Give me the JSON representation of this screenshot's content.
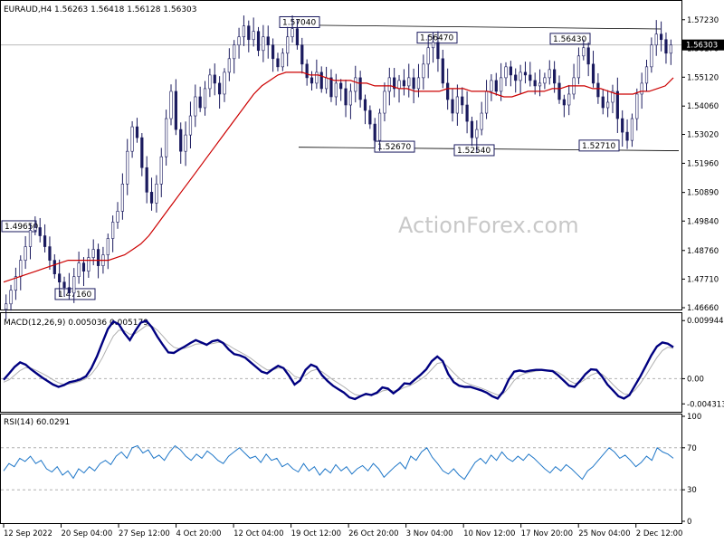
{
  "price_panel": {
    "header": "EURAUD,H4  1.56263 1.56418 1.56128 1.56303",
    "current_price_label": "1.56303",
    "watermark": "ActionForex.com",
    "y_ticks": [
      "1.57230",
      "1.56170",
      "1.55120",
      "1.54060",
      "1.53020",
      "1.51960",
      "1.50890",
      "1.49840",
      "1.48760",
      "1.47710",
      "1.46660"
    ]
  },
  "macd_panel": {
    "header": "MACD(12,26,9) 0.005036 0.005179",
    "y_ticks": [
      "0.009944",
      "0.00",
      "-0.004313"
    ]
  },
  "rsi_panel": {
    "header": "RSI(14) 60.0291",
    "y_ticks": [
      "100",
      "70",
      "30",
      "0"
    ]
  },
  "x_ticks": [
    "12 Sep 2022",
    "20 Sep 04:00",
    "27 Sep 12:00",
    "4 Oct 20:00",
    "12 Oct 04:00",
    "19 Oct 12:00",
    "26 Oct 20:00",
    "3 Nov 04:00",
    "10 Nov 12:00",
    "17 Nov 20:00",
    "25 Nov 04:00",
    "2 Dec 12:00"
  ],
  "colors": {
    "candles": "#1a1a5e",
    "sma": "#cc0000",
    "macd_line": "#000080",
    "signal_line": "#b0b0b0",
    "rsi": "#1f77c8",
    "grid": "#b0b0b0"
  },
  "chart_data": [
    {
      "type": "candlestick",
      "title": "EURAUD,H4",
      "ohlc_last": {
        "open": 1.56263,
        "high": 1.56418,
        "low": 1.56128,
        "close": 1.56303
      },
      "ylim": [
        1.4666,
        1.5782
      ],
      "x": [
        "12 Sep 2022",
        "20 Sep 04:00",
        "27 Sep 12:00",
        "4 Oct 20:00",
        "12 Oct 04:00",
        "19 Oct 12:00",
        "26 Oct 20:00",
        "3 Nov 04:00",
        "10 Nov 12:00",
        "17 Nov 20:00",
        "25 Nov 04:00",
        "2 Dec 12:00"
      ],
      "close_path": [
        1.468,
        1.473,
        1.478,
        1.484,
        1.489,
        1.495,
        1.496,
        1.493,
        1.489,
        1.484,
        1.479,
        1.476,
        1.474,
        1.472,
        1.478,
        1.483,
        1.48,
        1.485,
        1.488,
        1.482,
        1.486,
        1.492,
        1.498,
        1.502,
        1.512,
        1.524,
        1.533,
        1.529,
        1.518,
        1.509,
        1.505,
        1.512,
        1.522,
        1.536,
        1.546,
        1.532,
        1.524,
        1.53,
        1.537,
        1.544,
        1.54,
        1.547,
        1.552,
        1.549,
        1.545,
        1.553,
        1.558,
        1.563,
        1.566,
        1.57,
        1.565,
        1.568,
        1.561,
        1.566,
        1.563,
        1.558,
        1.555,
        1.56,
        1.566,
        1.569,
        1.563,
        1.556,
        1.551,
        1.549,
        1.553,
        1.547,
        1.551,
        1.544,
        1.549,
        1.547,
        1.541,
        1.546,
        1.551,
        1.543,
        1.539,
        1.534,
        1.528,
        1.538,
        1.546,
        1.551,
        1.547,
        1.55,
        1.548,
        1.551,
        1.547,
        1.551,
        1.556,
        1.562,
        1.564,
        1.558,
        1.549,
        1.543,
        1.538,
        1.544,
        1.541,
        1.535,
        1.529,
        1.532,
        1.538,
        1.546,
        1.55,
        1.546,
        1.551,
        1.555,
        1.552,
        1.55,
        1.553,
        1.552,
        1.55,
        1.548,
        1.549,
        1.551,
        1.554,
        1.549,
        1.543,
        1.541,
        1.545,
        1.551,
        1.559,
        1.562,
        1.556,
        1.549,
        1.544,
        1.54,
        1.542,
        1.546,
        1.536,
        1.531,
        1.528,
        1.536,
        1.545,
        1.549,
        1.555,
        1.563,
        1.567,
        1.565,
        1.56,
        1.563
      ],
      "sma_path": [
        1.476,
        1.477,
        1.478,
        1.479,
        1.48,
        1.481,
        1.482,
        1.483,
        1.484,
        1.484,
        1.484,
        1.484,
        1.484,
        1.484,
        1.485,
        1.486,
        1.488,
        1.49,
        1.493,
        1.497,
        1.501,
        1.505,
        1.509,
        1.513,
        1.517,
        1.521,
        1.525,
        1.529,
        1.533,
        1.537,
        1.541,
        1.545,
        1.548,
        1.55,
        1.552,
        1.553,
        1.553,
        1.553,
        1.552,
        1.552,
        1.551,
        1.55,
        1.55,
        1.55,
        1.549,
        1.549,
        1.548,
        1.548,
        1.548,
        1.547,
        1.547,
        1.546,
        1.546,
        1.546,
        1.546,
        1.547,
        1.547,
        1.547,
        1.546,
        1.546,
        1.546,
        1.545,
        1.544,
        1.544,
        1.545,
        1.546,
        1.546,
        1.546,
        1.547,
        1.547,
        1.548,
        1.548,
        1.548,
        1.547,
        1.547,
        1.546,
        1.545,
        1.545,
        1.545,
        1.546,
        1.546,
        1.547,
        1.548,
        1.551
      ],
      "levels": [
        {
          "label": "1.49650",
          "value": 1.4965
        },
        {
          "label": "1.47160",
          "value": 1.4716
        },
        {
          "label": "1.57040",
          "value": 1.5704
        },
        {
          "label": "1.56470",
          "value": 1.5647
        },
        {
          "label": "1.52670",
          "value": 1.5267
        },
        {
          "label": "1.52540",
          "value": 1.5254
        },
        {
          "label": "1.56430",
          "value": 1.5643
        },
        {
          "label": "1.52710",
          "value": 1.5271
        }
      ],
      "current_price": 1.56303
    },
    {
      "type": "line",
      "title": "MACD(12,26,9)",
      "values_last": {
        "macd": 0.005036,
        "signal": 0.005179
      },
      "ylim": [
        -0.0052,
        0.0106
      ],
      "series": [
        {
          "name": "MACD",
          "values": [
            -0.0002,
            0.0009,
            0.002,
            0.0028,
            0.0024,
            0.0016,
            0.0009,
            0.0002,
            -0.0004,
            -0.001,
            -0.0014,
            -0.0011,
            -0.0006,
            -0.0004,
            -0.0001,
            0.0004,
            0.0018,
            0.0038,
            0.0062,
            0.0085,
            0.0098,
            0.0093,
            0.0078,
            0.0066,
            0.0082,
            0.0096,
            0.0099,
            0.0088,
            0.0072,
            0.0058,
            0.0045,
            0.0044,
            0.005,
            0.0055,
            0.0061,
            0.0066,
            0.0062,
            0.0058,
            0.0064,
            0.0066,
            0.0061,
            0.005,
            0.0042,
            0.004,
            0.0036,
            0.0028,
            0.002,
            0.0012,
            0.0009,
            0.0016,
            0.0022,
            0.0018,
            0.0005,
            -0.001,
            -0.0003,
            0.0015,
            0.0024,
            0.002,
            0.0006,
            -0.0004,
            -0.0012,
            -0.0018,
            -0.0024,
            -0.0032,
            -0.0035,
            -0.003,
            -0.0026,
            -0.0028,
            -0.0024,
            -0.0015,
            -0.0017,
            -0.0025,
            -0.0018,
            -0.0008,
            -0.0009,
            -0.0001,
            0.0007,
            0.0016,
            0.003,
            0.0038,
            0.003,
            0.0008,
            -0.0006,
            -0.0012,
            -0.0014,
            -0.0014,
            -0.0017,
            -0.002,
            -0.0024,
            -0.003,
            -0.0034,
            -0.0022,
            -0.0002,
            0.0012,
            0.0014,
            0.0012,
            0.0014,
            0.0015,
            0.0015,
            0.0014,
            0.0013,
            0.0006,
            -0.0003,
            -0.0012,
            -0.0014,
            -0.0004,
            0.0008,
            0.0016,
            0.0015,
            0.0004,
            -0.001,
            -0.002,
            -0.003,
            -0.0034,
            -0.0028,
            -0.0012,
            0.0004,
            0.0022,
            0.004,
            0.0055,
            0.0062,
            0.006,
            0.0054
          ]
        },
        {
          "name": "Signal",
          "values": [
            -0.0006,
            -0.0002,
            0.0006,
            0.0014,
            0.0019,
            0.0018,
            0.0014,
            0.0009,
            0.0004,
            -0.0002,
            -0.0007,
            -0.001,
            -0.0009,
            -0.0007,
            -0.0004,
            0.0,
            0.0008,
            0.002,
            0.0036,
            0.0055,
            0.0073,
            0.0083,
            0.0082,
            0.0076,
            0.0077,
            0.0084,
            0.0091,
            0.009,
            0.0083,
            0.0073,
            0.0062,
            0.0054,
            0.0051,
            0.0052,
            0.0055,
            0.0059,
            0.006,
            0.0059,
            0.006,
            0.0062,
            0.0062,
            0.0057,
            0.0051,
            0.0046,
            0.0041,
            0.0035,
            0.0028,
            0.0021,
            0.0015,
            0.0015,
            0.0018,
            0.0018,
            0.0013,
            0.0004,
            0.0001,
            0.0006,
            0.0013,
            0.0016,
            0.0012,
            0.0005,
            -0.0002,
            -0.0008,
            -0.0014,
            -0.0021,
            -0.0027,
            -0.0029,
            -0.0028,
            -0.0028,
            -0.0026,
            -0.0021,
            -0.0019,
            -0.0021,
            -0.002,
            -0.0015,
            -0.0012,
            -0.0007,
            -0.0001,
            0.0006,
            0.0016,
            0.0026,
            0.0028,
            0.002,
            0.001,
            0.0001,
            -0.0006,
            -0.001,
            -0.0013,
            -0.0016,
            -0.002,
            -0.0024,
            -0.0028,
            -0.0026,
            -0.0016,
            -0.0003,
            0.0005,
            0.0009,
            0.0011,
            0.0013,
            0.0014,
            0.0014,
            0.0014,
            0.0011,
            0.0005,
            -0.0003,
            -0.0008,
            -0.0007,
            -0.0001,
            0.0006,
            0.001,
            0.0008,
            0.0,
            -0.001,
            -0.0019,
            -0.0026,
            -0.0027,
            -0.002,
            -0.0008,
            0.0006,
            0.0021,
            0.0036,
            0.0048,
            0.0054,
            0.0052
          ]
        }
      ]
    },
    {
      "type": "line",
      "title": "RSI(14)",
      "value_last": 60.0291,
      "ylim": [
        0,
        100
      ],
      "reference_lines": [
        70,
        30
      ],
      "series": [
        {
          "name": "RSI",
          "values": [
            48,
            55,
            52,
            60,
            57,
            62,
            55,
            58,
            50,
            47,
            52,
            44,
            48,
            41,
            50,
            46,
            52,
            48,
            55,
            58,
            54,
            62,
            66,
            60,
            70,
            72,
            65,
            68,
            60,
            63,
            58,
            66,
            72,
            68,
            62,
            58,
            64,
            60,
            67,
            63,
            58,
            55,
            62,
            66,
            70,
            65,
            60,
            62,
            56,
            64,
            58,
            60,
            52,
            55,
            50,
            47,
            55,
            48,
            52,
            44,
            50,
            46,
            54,
            48,
            52,
            45,
            50,
            53,
            48,
            55,
            50,
            42,
            47,
            52,
            56,
            50,
            62,
            58,
            66,
            70,
            61,
            55,
            48,
            45,
            50,
            44,
            40,
            48,
            56,
            60,
            55,
            63,
            58,
            66,
            60,
            57,
            62,
            58,
            64,
            60,
            55,
            50,
            46,
            52,
            48,
            54,
            50,
            45,
            40,
            48,
            52,
            58,
            64,
            70,
            66,
            60,
            63,
            58,
            52,
            56,
            62,
            58,
            70,
            66,
            64,
            60
          ]
        }
      ]
    }
  ]
}
